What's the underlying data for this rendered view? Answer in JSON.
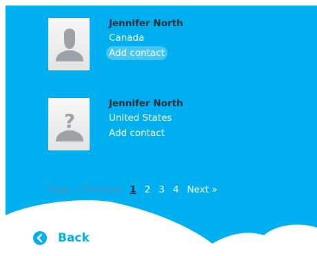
{
  "results": [
    {
      "name": "Jennifer North",
      "country": "Canada",
      "action_label": "Add contact",
      "avatar_icon": "person-silhouette-icon"
    },
    {
      "name": "Jennifer North",
      "country": "United States",
      "action_label": "Add contact",
      "avatar_icon": "unknown-person-icon"
    }
  ],
  "pagination": {
    "label": "Page",
    "previous": "« Previous",
    "pages": [
      "1",
      "2",
      "3",
      "4"
    ],
    "current": "1",
    "next": "Next »"
  },
  "footer": {
    "back_label": "Back",
    "back_icon": "back-arrow-icon"
  },
  "colors": {
    "panel": "#00aff0",
    "name_text": "#1e2b3a",
    "muted_text": "#5b93b3"
  }
}
